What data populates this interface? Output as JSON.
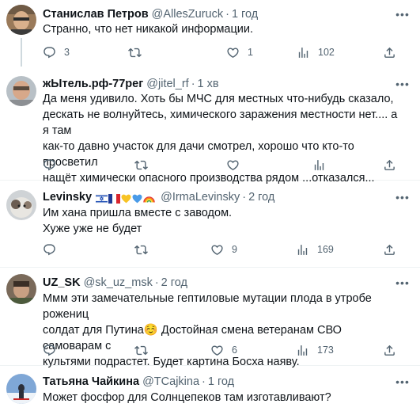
{
  "tweets": [
    {
      "name": "Станислав Петров",
      "handle": "@AllesZuruck",
      "time": "1 год",
      "text": "Странно, что нет никакой информации.",
      "replies": "3",
      "retweets": "",
      "likes": "1",
      "views": "102"
    },
    {
      "name": "жЫтель.рф-77рег",
      "handle": "@jitel_rf",
      "time": "1 хв",
      "text": "Да меня удивило. Хоть бы МЧС для местных что-нибудь сказало,\nдескать не волнуйтесь, химического заражения местности нет.... а я там\nкак-то давно участок для дачи смотрел, хорошо что кто-то просветил\nнащёт химически опасного производства рядом ...отказался...",
      "replies": "",
      "retweets": "",
      "likes": "",
      "views": ""
    },
    {
      "name": "Levinsky",
      "handle": "@IrmaLevinsky",
      "time": "2 год",
      "text": "Им хана пришла вместе с заводом.\nХуже уже не будет",
      "replies": "",
      "retweets": "",
      "likes": "9",
      "views": "169"
    },
    {
      "name": "UZ_SK",
      "handle": "@sk_uz_msk",
      "time": "2 год",
      "text": "Ммм эти замечательные гептиловые мутации плода в утробе рожениц\nсолдат для Путина☺️ Достойная смена ветеранам СВО самоварам с\nкультями подрастет. Будет картина Босха наяву.",
      "replies": "",
      "retweets": "",
      "likes": "6",
      "views": "173"
    },
    {
      "name": "Татьяна Чайкина",
      "handle": "@TCajkina",
      "time": "1 год",
      "text": "Может фосфор для Солнцепеков там изготавливают?"
    }
  ],
  "icons": {
    "reply": "reply-icon",
    "retweet": "retweet-icon",
    "like": "heart-icon",
    "views": "views-icon",
    "share": "share-icon",
    "more": "more-icon",
    "emoji_flags": [
      "israel-flag",
      "france-flag",
      "yellow-heart",
      "blue-heart",
      "rainbow"
    ]
  },
  "colors": {
    "text": "#0f1419",
    "secondary": "#536471",
    "divider": "#eff3f4",
    "thread_line": "#cfd9de"
  }
}
